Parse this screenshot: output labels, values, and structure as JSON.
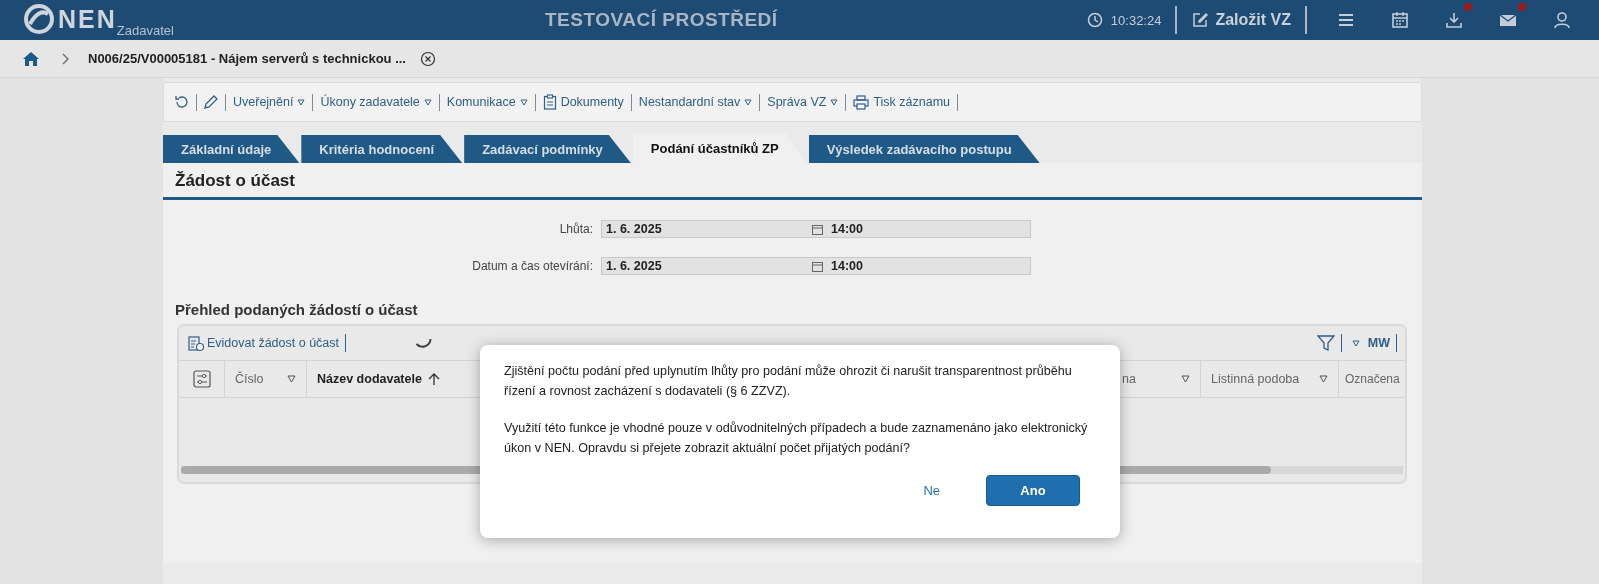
{
  "header": {
    "logo_text": "NEN",
    "logo_subtitle": "Zadavatel",
    "environment": "TESTOVACÍ PROSTŘEDÍ",
    "time": "10:32:24",
    "create_button": "Založit VZ",
    "icons": [
      {
        "kind": "menu",
        "badge": false
      },
      {
        "kind": "calendar",
        "badge": false
      },
      {
        "kind": "download",
        "badge": true
      },
      {
        "kind": "mail",
        "badge": true
      },
      {
        "kind": "user",
        "badge": false
      }
    ]
  },
  "breadcrumb": {
    "title": "N006/25/V00005181 - Nájem serverů s technickou ..."
  },
  "toolbar": [
    {
      "kind": "dropdown",
      "label": "Uveřejnění"
    },
    {
      "kind": "dropdown",
      "label": "Úkony zadavatele"
    },
    {
      "kind": "dropdown",
      "label": "Komunikace"
    },
    {
      "kind": "document",
      "label": "Dokumenty"
    },
    {
      "kind": "dropdown",
      "label": "Nestandardní stav"
    },
    {
      "kind": "dropdown",
      "label": "Správa VZ"
    },
    {
      "kind": "print",
      "label": "Tisk záznamu"
    }
  ],
  "tabs": [
    {
      "label": "Základní údaje",
      "selected": false
    },
    {
      "label": "Kritéria hodnocení",
      "selected": false
    },
    {
      "label": "Zadávací podmínky",
      "selected": false
    },
    {
      "label": "Podání účastníků ZP",
      "selected": true
    },
    {
      "label": "Výsledek zadávacího postupu",
      "selected": false
    }
  ],
  "section_title": "Žádost o účast",
  "fields": [
    {
      "label": "Lhůta:",
      "date": "1. 6. 2025",
      "time": "14:00"
    },
    {
      "label": "Datum a čas otevírání:",
      "date": "1. 6. 2025",
      "time": "14:00"
    }
  ],
  "table": {
    "title": "Přehled podaných žádostí o účast",
    "add_button": "Evidovat žádost o účast",
    "columns_button": "MW",
    "columns": [
      {
        "label": "Číslo",
        "kind": "filter"
      },
      {
        "label": "Název dodavatele",
        "kind": "sorted"
      },
      {
        "label": "na",
        "kind": "filter"
      },
      {
        "label": "Listinná podoba",
        "kind": "filter"
      },
      {
        "label": "Označena",
        "kind": "plain"
      }
    ]
  },
  "dialog": {
    "paragraphs": [
      "Zjištění počtu podání před uplynutím lhůty pro podání může ohrozit či narušit transparentnost průběhu řízení a rovnost zacházení s dodavateli (§ 6 ZZVZ).",
      "Využití této funkce je vhodné pouze v odůvodnitelných případech a bude zaznamenáno jako elektronický úkon v NEN. Opravdu si přejete zobrazit aktuální počet přijatých podání?"
    ],
    "cancel_button": "Ne",
    "confirm_button": "Ano"
  }
}
